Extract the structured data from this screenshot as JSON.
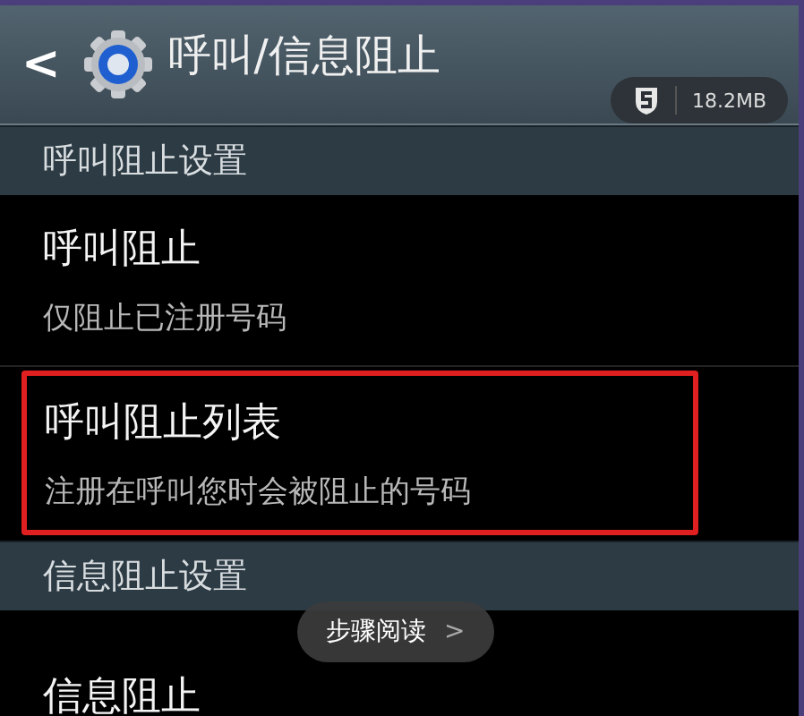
{
  "header": {
    "back": "<",
    "title": "呼叫/信息阻止",
    "badge": "18.2MB"
  },
  "sections": [
    {
      "title": "呼叫阻止设置",
      "items": [
        {
          "title": "呼叫阻止",
          "subtitle": "仅阻止已注册号码",
          "highlighted": false
        },
        {
          "title": "呼叫阻止列表",
          "subtitle": "注册在呼叫您时会被阻止的号码",
          "highlighted": true
        }
      ]
    },
    {
      "title": "信息阻止设置",
      "items": [
        {
          "title": "信息阻止",
          "highlighted": false
        }
      ]
    }
  ],
  "overlay": {
    "label": "步骤阅读",
    "chevron": ">"
  }
}
